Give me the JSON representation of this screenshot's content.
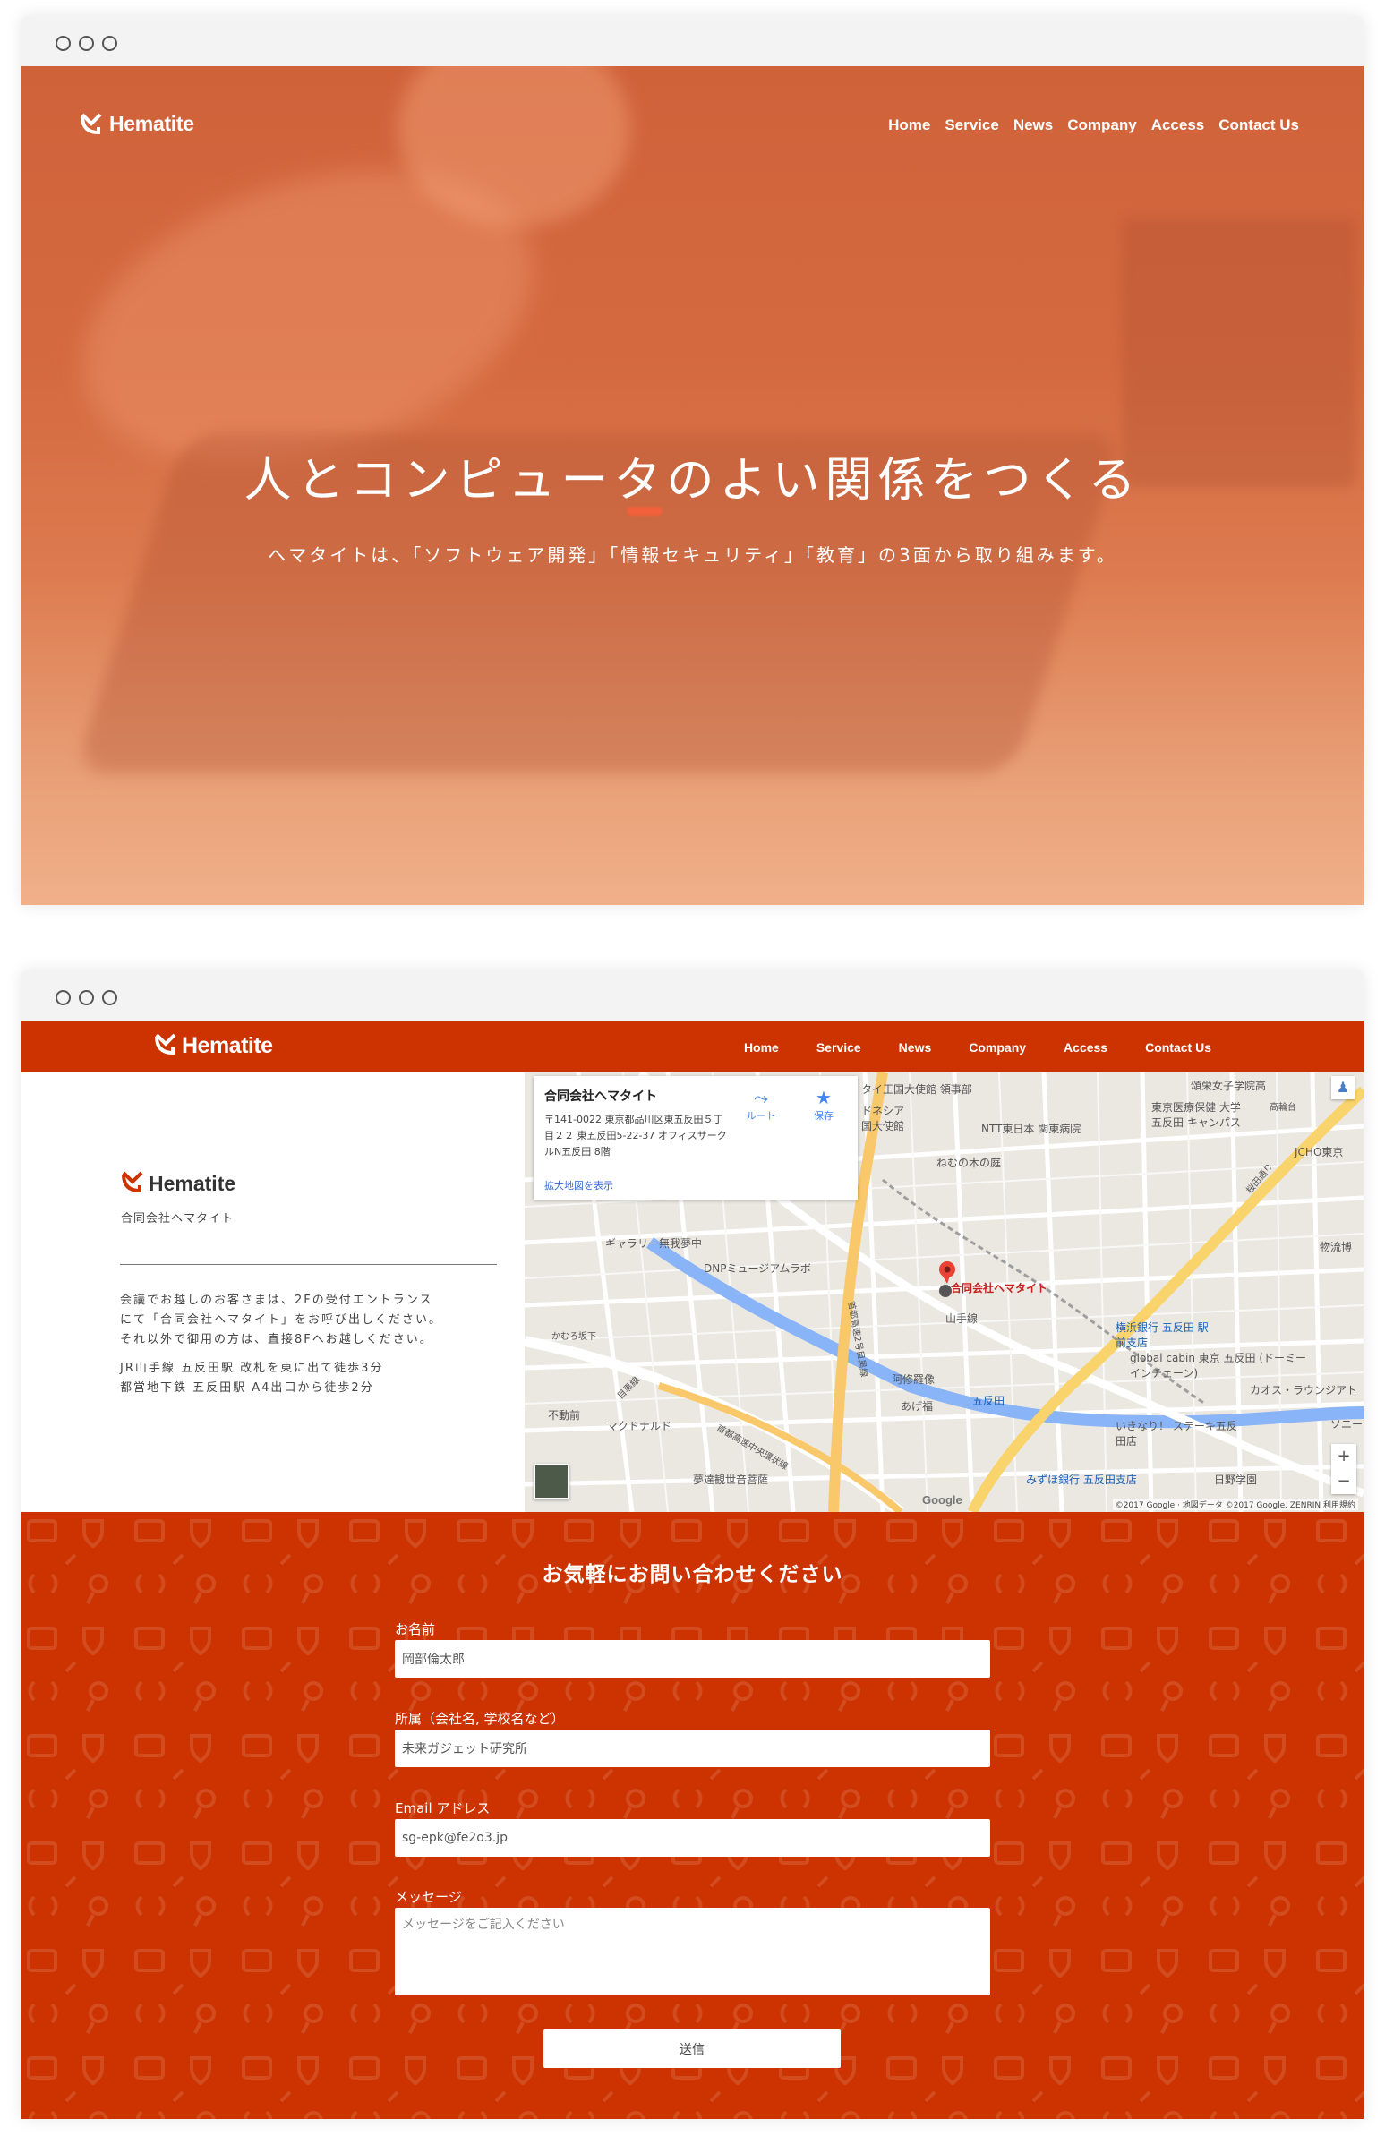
{
  "brand": {
    "name": "Hematite",
    "accent": "#cc3300"
  },
  "hero": {
    "nav": [
      "Home",
      "Service",
      "News",
      "Company",
      "Access",
      "Contact Us"
    ],
    "title": "人とコンピュータのよい関係をつくる",
    "subtitle": "ヘマタイトは、「ソフトウェア開発」「情報セキュリティ」「教育」の3面から取り組みます。"
  },
  "page2": {
    "nav": [
      "Home",
      "Service",
      "News",
      "Company",
      "Access",
      "Contact Us"
    ],
    "info": {
      "company": "合同会社ヘマタイト",
      "para1": [
        "会議でお越しのお客さまは、2Fの受付エントランス",
        "にて「合同会社ヘマタイト」をお呼び出しください。",
        "それ以外で御用の方は、直接8Fへお越しください。"
      ],
      "para2": [
        "JR山手線 五反田駅 改札を東に出て徒歩3分",
        "都営地下鉄 五反田駅 A4出口から徒歩2分"
      ]
    },
    "map": {
      "card_title": "合同会社ヘマタイト",
      "card_address": "〒141-0022 東京都品川区東五反田５丁目２２ 東五反田5-22-37 オフィスサークルN五反田 8階",
      "card_link": "拡大地図を表示",
      "route_label": "ルート",
      "save_label": "保存",
      "pin_label": "合同会社ヘマタイト",
      "labels": {
        "l1": "タイ王国大使館 領事部",
        "l2": "ドネシア 国大使館",
        "l3": "NTT東日本 関東病院",
        "l4": "東京医療保健 大学 五反田 キャンパス",
        "l5": "ねむの木の庭",
        "l6": "ギャラリー無我夢中",
        "l7": "DNPミュージアムラボ",
        "l8": "横浜銀行 五反田 駅前支店",
        "l9": "global cabin 東京 五反田 (ドーミーインチェーン)",
        "l10": "阿修羅像",
        "l11": "カオス・ラウンジアト",
        "l12": "いきなり！ ステーキ五反田店",
        "l13": "マクドナルド",
        "l14": "夢達観世音菩薩",
        "l15": "みずほ銀行 五反田支店",
        "l16": "五反田",
        "l17": "あげ福",
        "l18": "頌栄女子学院高",
        "l19": "JCHO東京",
        "l20": "日野学園",
        "l21": "山手線",
        "l22": "不動前",
        "l23": "物流博",
        "l24": "かむろ坂下",
        "l25": "高輪台",
        "l26": "目黒線",
        "l27": "首都高速中央環状線",
        "l28": "首都高速2号目黒線",
        "l29": "桜田通り",
        "l30": "ソニー",
        "l31": "利用規約"
      },
      "attribution": "©2017 Google · 地図データ ©2017 Google, ZENRIN",
      "google": "Google",
      "zoom_in": "+",
      "zoom_out": "−"
    },
    "contact": {
      "title": "お気軽にお問い合わせください",
      "name_label": "お名前",
      "name_value": "岡部倫太郎",
      "org_label": "所属（会社名, 学校名など）",
      "org_value": "未来ガジェット研究所",
      "email_label": "Email アドレス",
      "email_value": "sg-epk@fe2o3.jp",
      "message_label": "メッセージ",
      "message_placeholder": "メッセージをご記入ください",
      "submit_label": "送信"
    }
  }
}
